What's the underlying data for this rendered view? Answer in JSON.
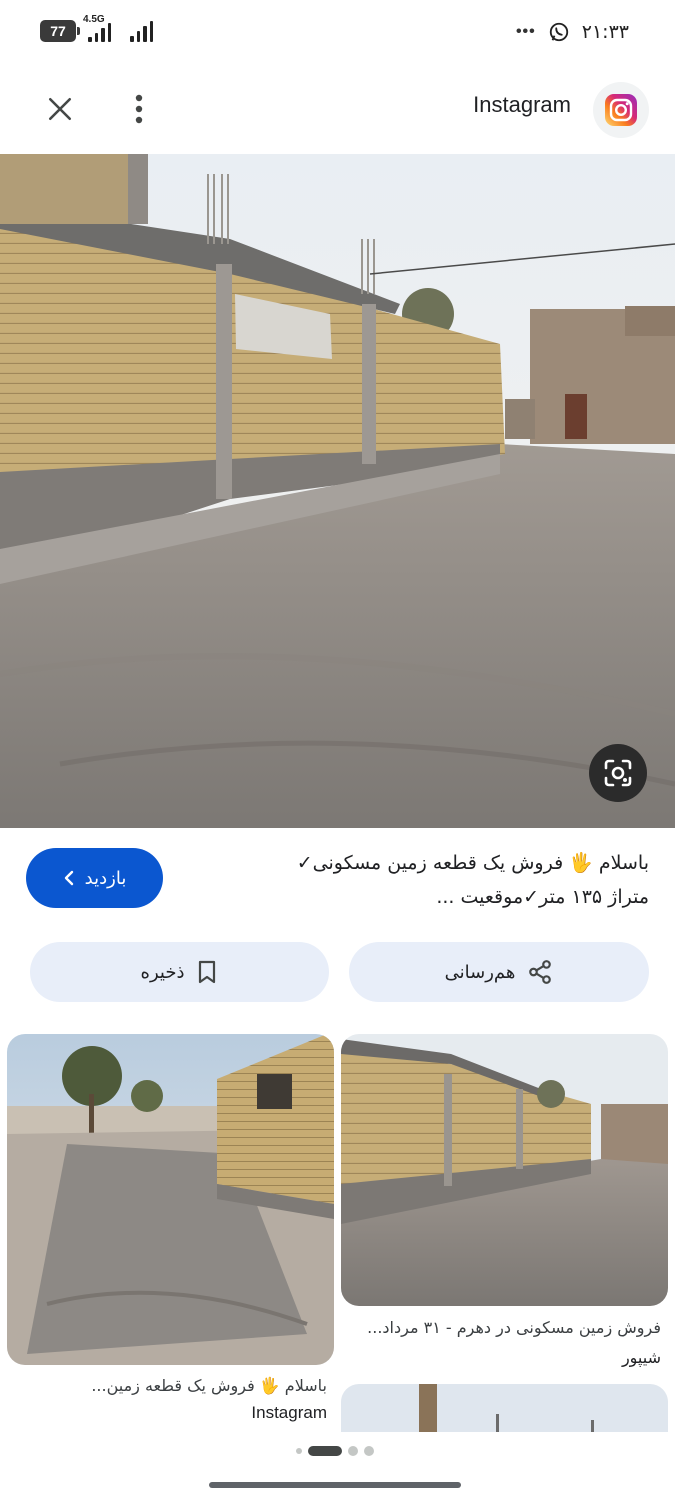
{
  "status_bar": {
    "battery": "77",
    "network": "4.5G",
    "time": "۲۱:۳۳",
    "overflow": "•••"
  },
  "header": {
    "source_name": "Instagram",
    "close_icon": "close-icon",
    "menu_icon": "more-vert-icon",
    "logo_icon": "instagram-logo"
  },
  "main_image": {
    "lens_icon": "google-lens-icon"
  },
  "caption": {
    "line1": "باسلام 🖐 فروش یک قطعه زمین مسکونی✓",
    "line2": "متراژ ۱۳۵ متر✓موقعیت ..."
  },
  "visit_button": {
    "label": "بازدید"
  },
  "actions": {
    "share_label": "هم‌رسانی",
    "save_label": "ذخیره"
  },
  "related": [
    {
      "title": "باسلام 🖐 فروش یک قطعه زمین...",
      "source": "Instagram"
    },
    {
      "title": "فروش زمین مسکونی در دهرم - ۳۱ مرداد...",
      "source": "شیپور"
    }
  ],
  "pager": {
    "count": 5,
    "active": 1
  },
  "colors": {
    "primary": "#0b57d0",
    "chip_bg": "#e8eef9",
    "text": "#202124"
  }
}
